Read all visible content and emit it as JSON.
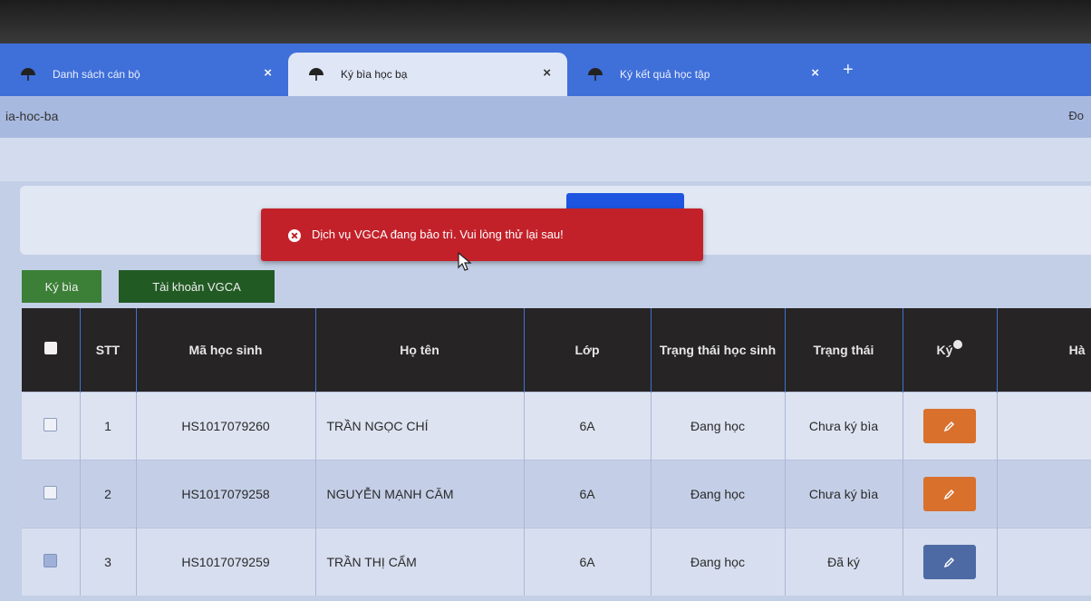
{
  "browser": {
    "tabs": [
      {
        "label": "Danh sách cán bộ",
        "active": false
      },
      {
        "label": "Ký bìa học bạ",
        "active": true
      },
      {
        "label": "Ký kết quả học tập",
        "active": false
      }
    ],
    "tab_close_symbol": "×",
    "new_tab_symbol": "+",
    "url_fragment": "ia-hoc-ba",
    "url_right_fragment": "Đo"
  },
  "toast": {
    "message": "Dịch vụ VGCA đang bảo trì. Vui lòng thử lại sau!",
    "color": "#c3212a",
    "icon": "close-circle-icon"
  },
  "toolbar": {
    "sign_cover_label": "Ký bìa",
    "vgca_account_label": "Tài khoản VGCA"
  },
  "table": {
    "headers": {
      "stt": "STT",
      "student_id": "Mã học sinh",
      "name": "Họ tên",
      "class": "Lớp",
      "student_status": "Trạng thái học sinh",
      "status": "Trạng thái",
      "sign": "Ký",
      "last": "Hà"
    },
    "rows": [
      {
        "stt": "1",
        "student_id": "HS1017079260",
        "name": "TRẦN NGỌC CHÍ",
        "class": "6A",
        "student_status": "Đang học",
        "status": "Chưa ký bìa",
        "checked": false,
        "sign_color": "#d9702c"
      },
      {
        "stt": "2",
        "student_id": "HS1017079258",
        "name": "NGUYỄN MẠNH CĂM",
        "class": "6A",
        "student_status": "Đang học",
        "status": "Chưa ký bìa",
        "checked": false,
        "sign_color": "#d9702c"
      },
      {
        "stt": "3",
        "student_id": "HS1017079259",
        "name": "TRẦN THỊ CẨM",
        "class": "6A",
        "student_status": "Đang học",
        "status": "Đã ký",
        "checked": true,
        "sign_color": "#4d6aa5"
      }
    ]
  }
}
